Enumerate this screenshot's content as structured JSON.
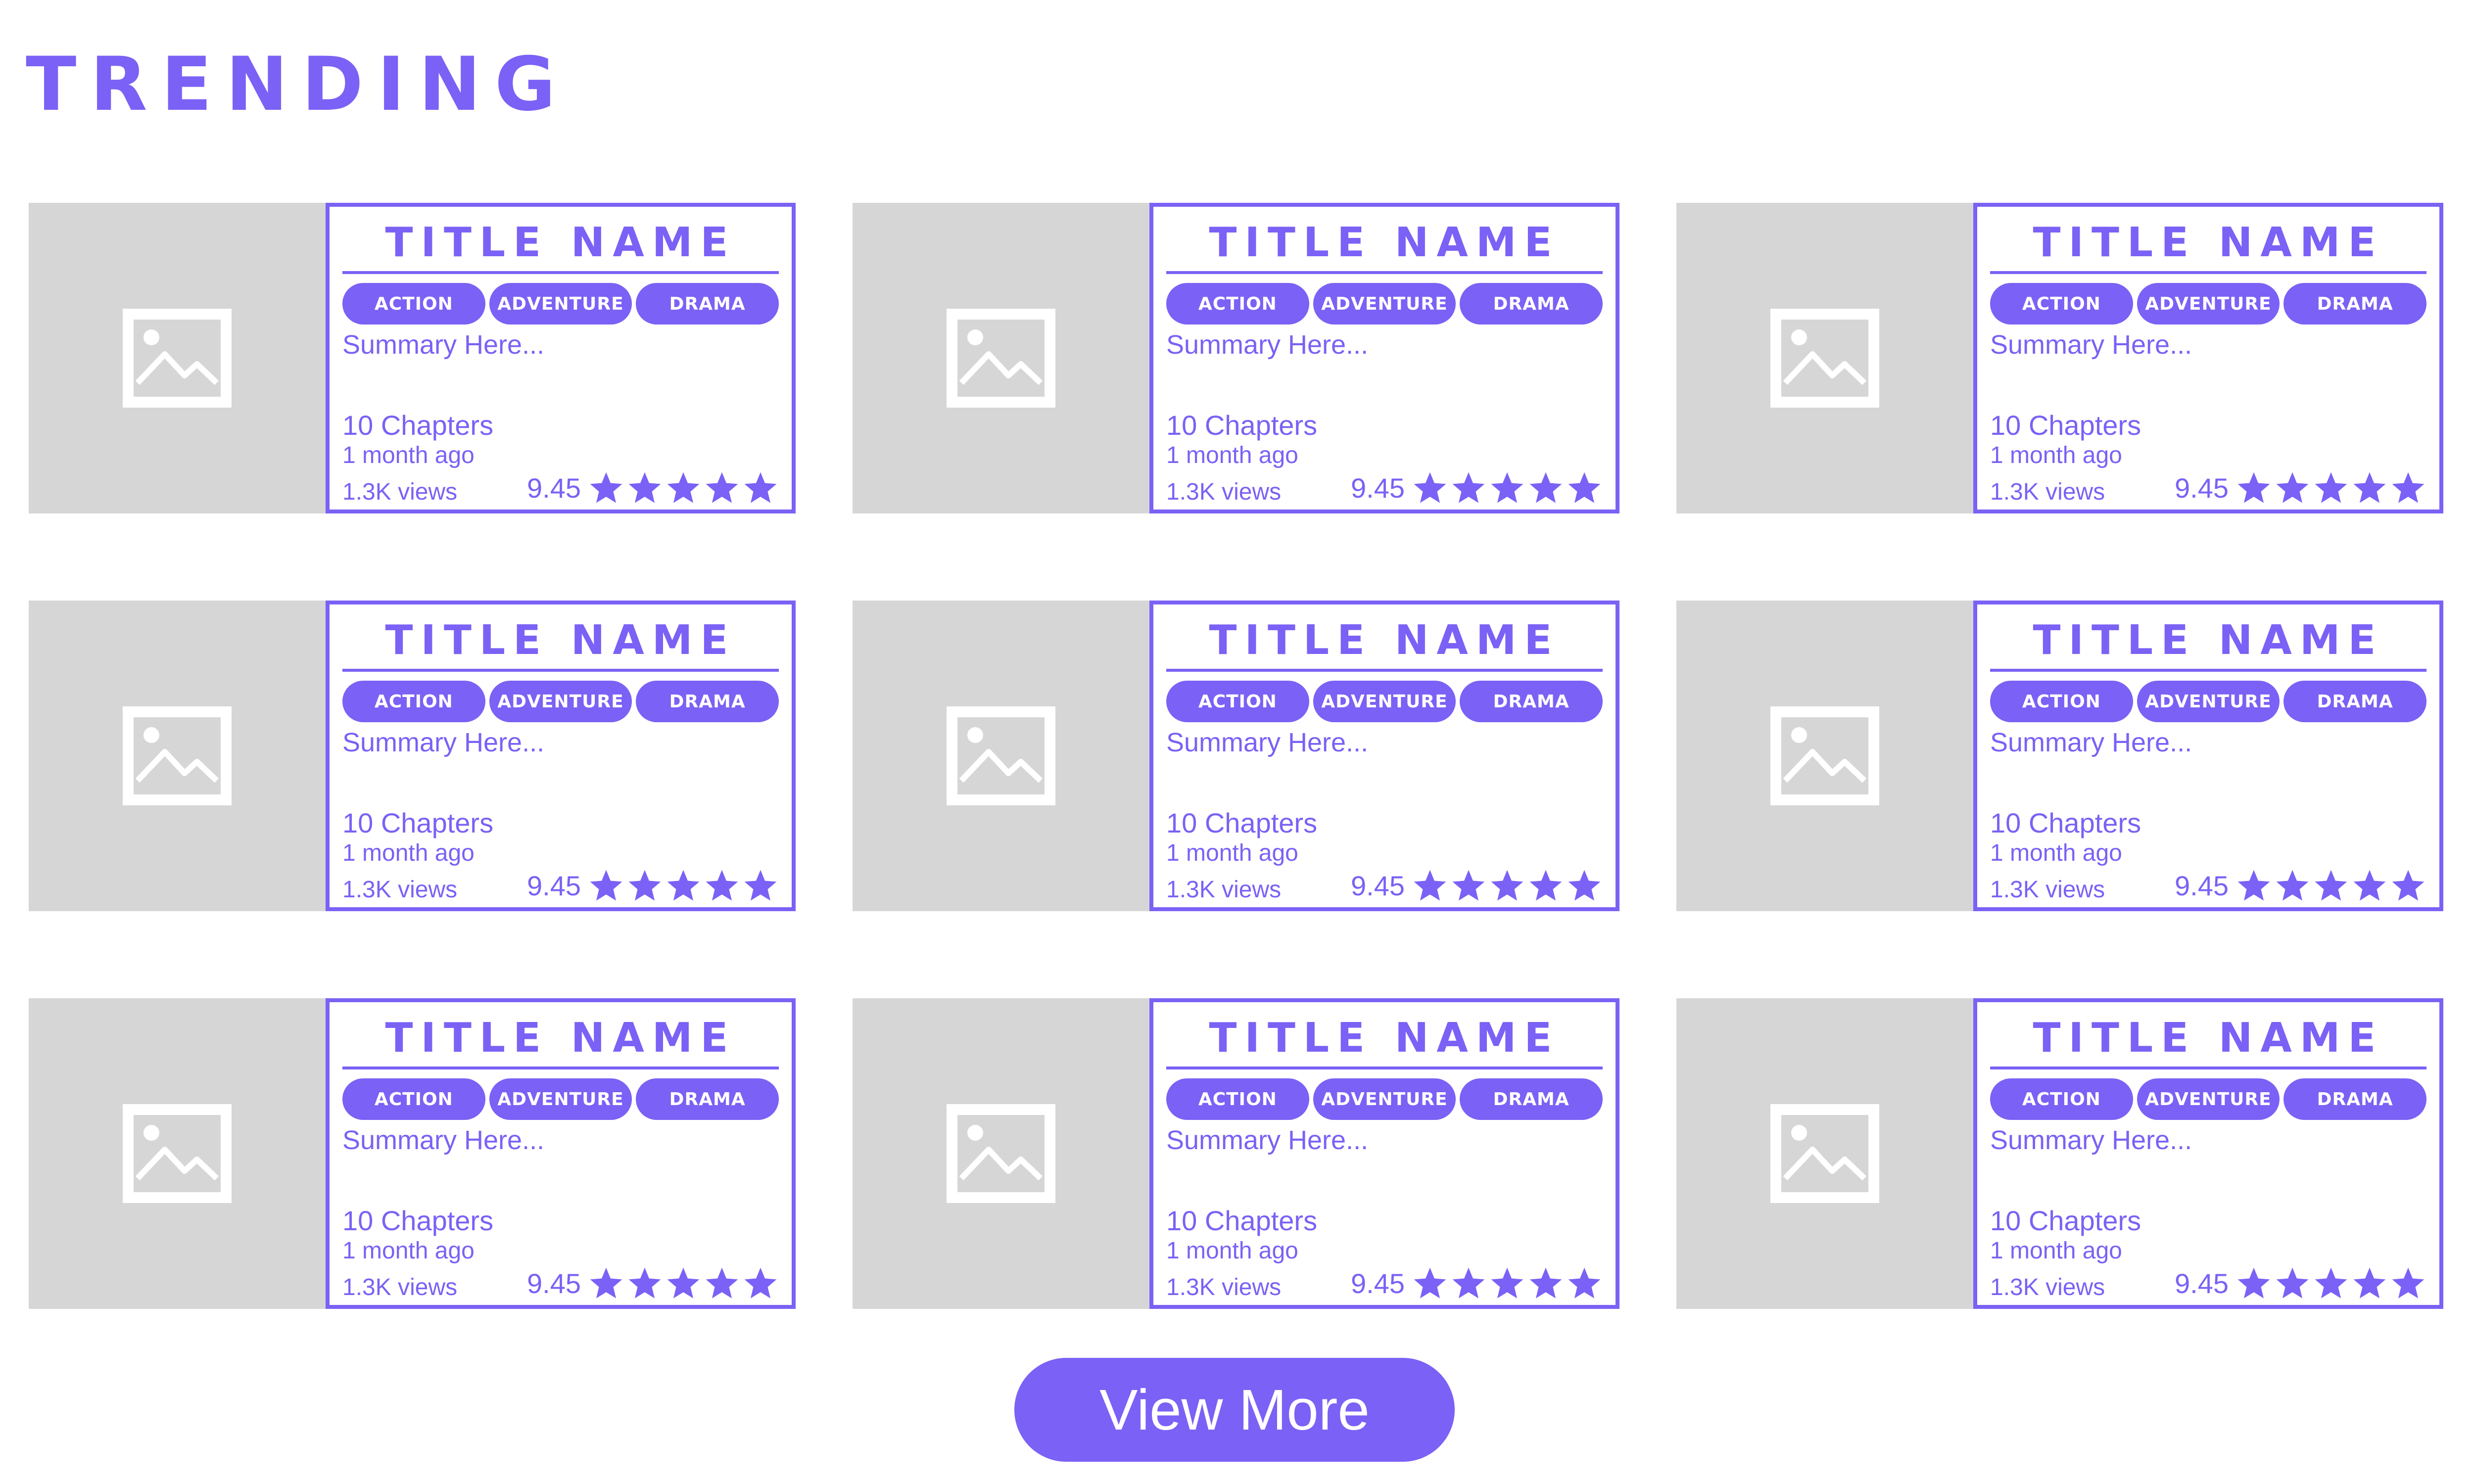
{
  "page": {
    "title": "TRENDING",
    "accent_color": "#7b61f5",
    "placeholder_color": "#d6d6d6"
  },
  "cards": [
    {
      "title": "TITLE NAME",
      "tags": [
        "ACTION",
        "ADVENTURE",
        "DRAMA"
      ],
      "summary": "Summary Here...",
      "chapters": "10 Chapters",
      "updated": "1 month ago",
      "views": "1.3K views",
      "rating": "9.45",
      "stars": 5,
      "thumbnail_icon": "image-placeholder-icon"
    },
    {
      "title": "TITLE NAME",
      "tags": [
        "ACTION",
        "ADVENTURE",
        "DRAMA"
      ],
      "summary": "Summary Here...",
      "chapters": "10 Chapters",
      "updated": "1 month ago",
      "views": "1.3K views",
      "rating": "9.45",
      "stars": 5,
      "thumbnail_icon": "image-placeholder-icon"
    },
    {
      "title": "TITLE NAME",
      "tags": [
        "ACTION",
        "ADVENTURE",
        "DRAMA"
      ],
      "summary": "Summary Here...",
      "chapters": "10 Chapters",
      "updated": "1 month ago",
      "views": "1.3K views",
      "rating": "9.45",
      "stars": 5,
      "thumbnail_icon": "image-placeholder-icon"
    },
    {
      "title": "TITLE NAME",
      "tags": [
        "ACTION",
        "ADVENTURE",
        "DRAMA"
      ],
      "summary": "Summary Here...",
      "chapters": "10 Chapters",
      "updated": "1 month ago",
      "views": "1.3K views",
      "rating": "9.45",
      "stars": 5,
      "thumbnail_icon": "image-placeholder-icon"
    },
    {
      "title": "TITLE NAME",
      "tags": [
        "ACTION",
        "ADVENTURE",
        "DRAMA"
      ],
      "summary": "Summary Here...",
      "chapters": "10 Chapters",
      "updated": "1 month ago",
      "views": "1.3K views",
      "rating": "9.45",
      "stars": 5,
      "thumbnail_icon": "image-placeholder-icon"
    },
    {
      "title": "TITLE NAME",
      "tags": [
        "ACTION",
        "ADVENTURE",
        "DRAMA"
      ],
      "summary": "Summary Here...",
      "chapters": "10 Chapters",
      "updated": "1 month ago",
      "views": "1.3K views",
      "rating": "9.45",
      "stars": 5,
      "thumbnail_icon": "image-placeholder-icon"
    },
    {
      "title": "TITLE NAME",
      "tags": [
        "ACTION",
        "ADVENTURE",
        "DRAMA"
      ],
      "summary": "Summary Here...",
      "chapters": "10 Chapters",
      "updated": "1 month ago",
      "views": "1.3K views",
      "rating": "9.45",
      "stars": 5,
      "thumbnail_icon": "image-placeholder-icon"
    },
    {
      "title": "TITLE NAME",
      "tags": [
        "ACTION",
        "ADVENTURE",
        "DRAMA"
      ],
      "summary": "Summary Here...",
      "chapters": "10 Chapters",
      "updated": "1 month ago",
      "views": "1.3K views",
      "rating": "9.45",
      "stars": 5,
      "thumbnail_icon": "image-placeholder-icon"
    },
    {
      "title": "TITLE NAME",
      "tags": [
        "ACTION",
        "ADVENTURE",
        "DRAMA"
      ],
      "summary": "Summary Here...",
      "chapters": "10 Chapters",
      "updated": "1 month ago",
      "views": "1.3K views",
      "rating": "9.45",
      "stars": 5,
      "thumbnail_icon": "image-placeholder-icon"
    }
  ],
  "footer": {
    "view_more_label": "View More"
  }
}
